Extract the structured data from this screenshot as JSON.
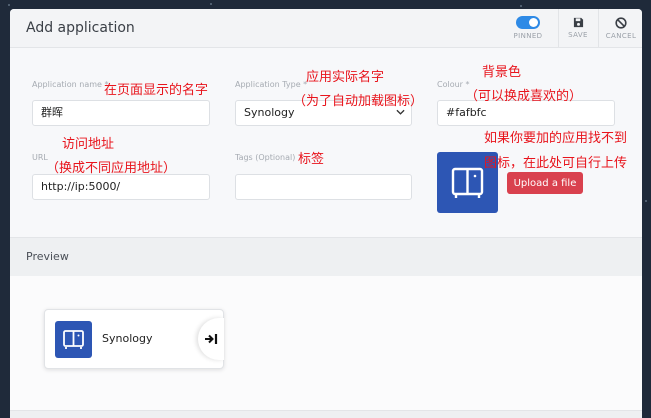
{
  "header": {
    "title": "Add application",
    "pinned_label": "PINNED",
    "save_label": "SAVE",
    "cancel_label": "CANCEL"
  },
  "form": {
    "name_label": "Application name *",
    "name_value": "群晖",
    "type_label": "Application Type *",
    "type_value": "Synology",
    "colour_label": "Colour *",
    "colour_value": "#fafbfc",
    "url_label": "URL",
    "url_value": "http://ip:5000/",
    "tags_label": "Tags (Optional)",
    "tags_value": "",
    "upload_label": "Upload a file"
  },
  "annotations": {
    "name_note": "在页面显示的名字",
    "type_note_1": "应用实际名字",
    "type_note_2": "（为了自动加载图标）",
    "colour_note_1": "背景色",
    "colour_note_2": "（可以换成喜欢的）",
    "url_note_1": "访问地址",
    "url_note_2": "（换成不同应用地址）",
    "tags_note": "标签",
    "icon_note_1": "如果你要加的应用找不到",
    "icon_note_2": "图标，在此处可自行上传"
  },
  "preview": {
    "title": "Preview",
    "app_name": "Synology"
  },
  "colors": {
    "accent": "#2e8ae6",
    "tile": "#2d56b4",
    "upload": "#d9414e",
    "annotation": "#e8141c"
  },
  "icons": [
    "toggle-icon",
    "save-icon",
    "cancel-icon",
    "chevron-down-icon",
    "synology-nas-icon",
    "open-arrow-icon"
  ]
}
